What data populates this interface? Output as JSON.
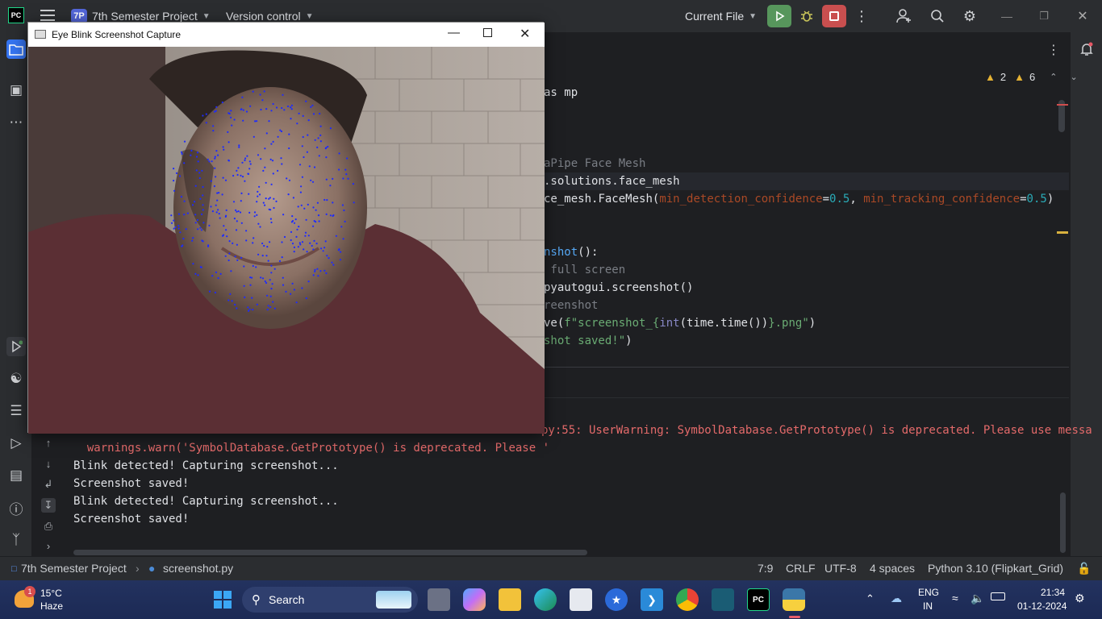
{
  "titlebar": {
    "logo": "PC",
    "project_badge": "7P",
    "project_name": "7th Semester Project",
    "vcs_label": "Version control",
    "run_config": "Current File",
    "colors": {
      "run": "#57965c",
      "stop": "#c94f4f",
      "badge": "#5366d9"
    }
  },
  "editor": {
    "inspections": {
      "warnings": "2",
      "weak_warnings": "6"
    },
    "lines": [
      {
        "parts": [
          {
            "t": "as mp",
            "c": ""
          }
        ]
      },
      {
        "parts": [
          {
            "t": "aPipe Face Mesh",
            "c": "kw-comment"
          }
        ]
      },
      {
        "parts": [
          {
            "t": ".solutions.face_mesh",
            "c": ""
          }
        ]
      },
      {
        "parts": [
          {
            "t": "ce_mesh",
            "c": ""
          },
          {
            "t": ".FaceMesh(",
            "c": ""
          },
          {
            "t": "min_detection_confidence",
            "c": "kw-param"
          },
          {
            "t": "=",
            "c": ""
          },
          {
            "t": "0.5",
            "c": "kw-num"
          },
          {
            "t": ", ",
            "c": ""
          },
          {
            "t": "min_tracking_confidence",
            "c": "kw-param"
          },
          {
            "t": "=",
            "c": ""
          },
          {
            "t": "0.5",
            "c": "kw-num"
          },
          {
            "t": ")",
            "c": ""
          }
        ]
      },
      {
        "parts": [
          {
            "t": "nshot",
            "c": "kw-fn"
          },
          {
            "t": "():",
            "c": ""
          }
        ]
      },
      {
        "parts": [
          {
            "t": " full screen",
            "c": "kw-comment"
          }
        ]
      },
      {
        "parts": [
          {
            "t": "pyautogui.screenshot()",
            "c": ""
          }
        ]
      },
      {
        "parts": [
          {
            "t": "reenshot",
            "c": "kw-comment"
          }
        ]
      },
      {
        "parts": [
          {
            "t": "ve(",
            "c": ""
          },
          {
            "t": "f\"screenshot_{",
            "c": "kw-str"
          },
          {
            "t": "int",
            "c": "kw-builtin"
          },
          {
            "t": "(time.time())",
            "c": ""
          },
          {
            "t": "}.png\"",
            "c": "kw-str"
          },
          {
            "t": ")",
            "c": ""
          }
        ]
      },
      {
        "parts": [
          {
            "t": "shot saved!\"",
            "c": "kw-str"
          },
          {
            "t": ")",
            "c": ""
          }
        ]
      }
    ]
  },
  "run_output": {
    "warning_line1": "py:55: UserWarning: SymbolDatabase.GetPrototype() is deprecated. Please use messa",
    "warning_line2": "  warnings.warn('SymbolDatabase.GetPrototype() is deprecated. Please '",
    "lines": [
      "Blink detected! Capturing screenshot...",
      "Screenshot saved!",
      "Blink detected! Capturing screenshot...",
      "Screenshot saved!"
    ]
  },
  "statusbar": {
    "project": "7th Semester Project",
    "file": "screenshot.py",
    "position": "7:9",
    "line_sep": "CRLF",
    "encoding": "UTF-8",
    "indent": "4 spaces",
    "interpreter": "Python 3.10 (Flipkart_Grid)"
  },
  "camera_window": {
    "title": "Eye Blink Screenshot Capture"
  },
  "taskbar": {
    "weather_temp": "15°C",
    "weather_desc": "Haze",
    "weather_badge": "1",
    "search_label": "Search",
    "lang": "ENG",
    "region": "IN",
    "time": "21:34",
    "date": "01-12-2024"
  }
}
